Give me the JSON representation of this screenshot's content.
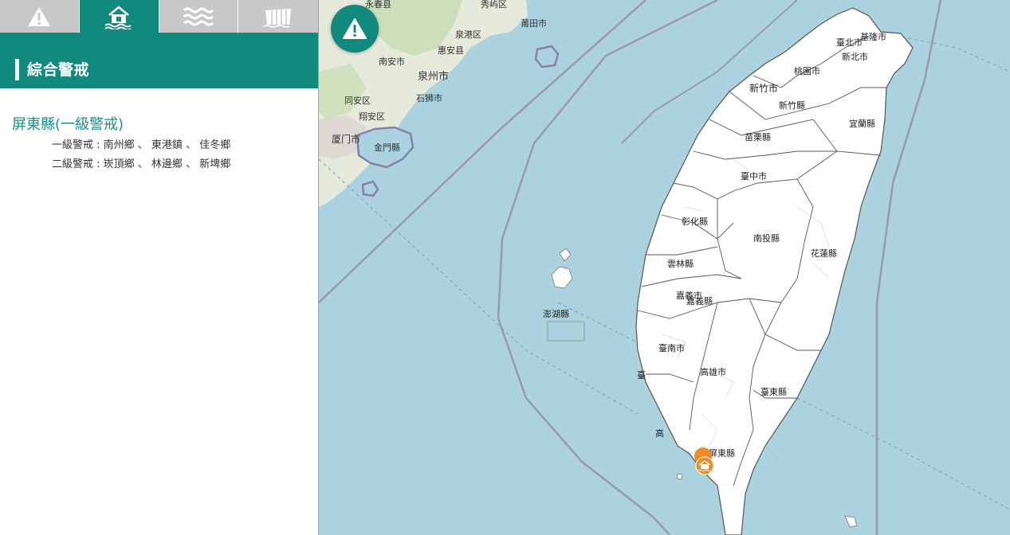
{
  "tabs": [
    {
      "icon": "warning-icon"
    },
    {
      "icon": "flooded-house-icon"
    },
    {
      "icon": "waves-icon"
    },
    {
      "icon": "dam-icon"
    }
  ],
  "panel": {
    "title": "綜合警戒",
    "county": "屏東縣(一級警戒)",
    "rows": [
      {
        "label": "一級警戒",
        "value": "南州鄉 、 東港鎮 、 佳冬鄉"
      },
      {
        "label": "二級警戒",
        "value": "崁頂鄉 、 林邊鄉 、 新埤鄉"
      }
    ]
  },
  "map": {
    "mainland_labels": [
      "永春县",
      "秀屿区",
      "泉港区",
      "莆田市",
      "南安市",
      "惠安县",
      "泉州市",
      "同安区",
      "石狮市",
      "翔安区",
      "厦门市",
      "金門縣"
    ],
    "county_labels": [
      "臺北市",
      "基隆市",
      "新北市",
      "桃園市",
      "新竹市",
      "新竹縣",
      "宜蘭縣",
      "苗栗縣",
      "臺中市",
      "彰化縣",
      "南投縣",
      "花蓮縣",
      "雲林縣",
      "嘉義市",
      "嘉義縣",
      "澎湖縣",
      "臺南市",
      "高雄市",
      "臺東縣",
      "屏東縣",
      "臺",
      "高"
    ],
    "marker_icon": "flooded-house-icon",
    "colors": {
      "sea": "#aad3df",
      "land_tw": "#ffffff",
      "land_cn": "#f2efe9",
      "accent": "#0f8a7d",
      "marker": "#f08a24"
    }
  },
  "fab": {
    "icon": "warning-icon"
  }
}
